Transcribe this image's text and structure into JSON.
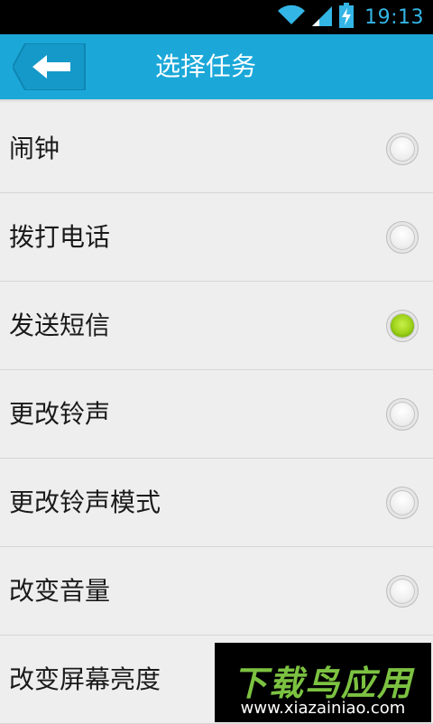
{
  "status_bar": {
    "time": "19:13",
    "icons": [
      "wifi-icon",
      "signal-icon",
      "battery-charging-icon"
    ]
  },
  "header": {
    "title": "选择任务",
    "back_icon": "back-arrow-icon",
    "color": "#1ba8d9"
  },
  "tasks": [
    {
      "label": "闹钟",
      "selected": false
    },
    {
      "label": "拨打电话",
      "selected": false
    },
    {
      "label": "发送短信",
      "selected": true
    },
    {
      "label": "更改铃声",
      "selected": false
    },
    {
      "label": "更改铃声模式",
      "selected": false
    },
    {
      "label": "改变音量",
      "selected": false
    },
    {
      "label": "改变屏幕亮度",
      "selected": false
    }
  ],
  "watermark": {
    "brand": "下载鸟应用",
    "url": "www.xiazainiao.com"
  },
  "accent_colors": {
    "selected_radio": "#8cc63f",
    "status_text": "#33b5e5"
  }
}
